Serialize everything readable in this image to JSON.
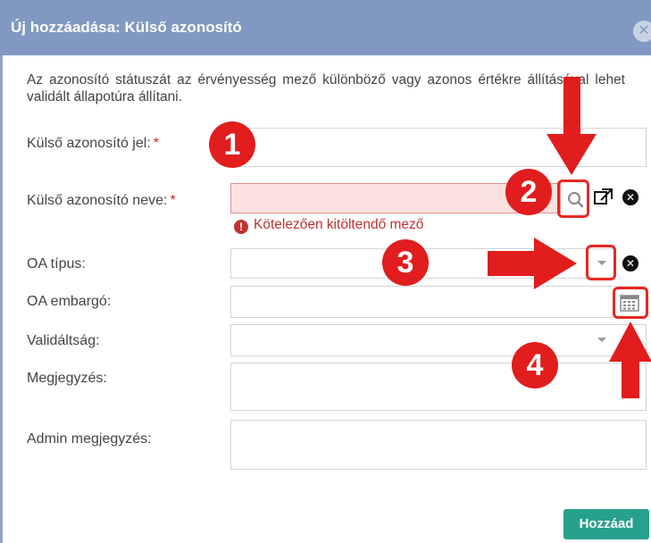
{
  "dialog": {
    "title": "Új hozzáadása: Külső azonosító",
    "close_icon": "close-icon"
  },
  "description": "Az azonosító státuszát az érvényesség mező különböző vagy azonos értékre állításával lehet validált állapotúra állítani.",
  "form": {
    "external_id_sign": {
      "label": "Külső azonosító jel:",
      "required_mark": "*",
      "value": ""
    },
    "external_id_name": {
      "label": "Külső azonosító neve:",
      "required_mark": "*",
      "value": "",
      "error": "Kötelezően kitöltendő mező"
    },
    "oa_type": {
      "label": "OA típus:",
      "value": ""
    },
    "oa_embargo": {
      "label": "OA embargó:",
      "value": ""
    },
    "validity": {
      "label": "Validáltság:",
      "value": ""
    },
    "note": {
      "label": "Megjegyzés:",
      "value": ""
    },
    "admin_note": {
      "label": "Admin megjegyzés:",
      "value": ""
    }
  },
  "annotations": {
    "badge_1": "1",
    "badge_2": "2",
    "badge_3": "3",
    "badge_4": "4"
  },
  "actions": {
    "submit_label": "Hozzáad"
  },
  "colors": {
    "titlebar": "#8199c1",
    "error_bg": "#fde1e1",
    "error_text": "#c0322f",
    "annotation_red": "#e11d1d",
    "submit_green": "#27a18c"
  }
}
